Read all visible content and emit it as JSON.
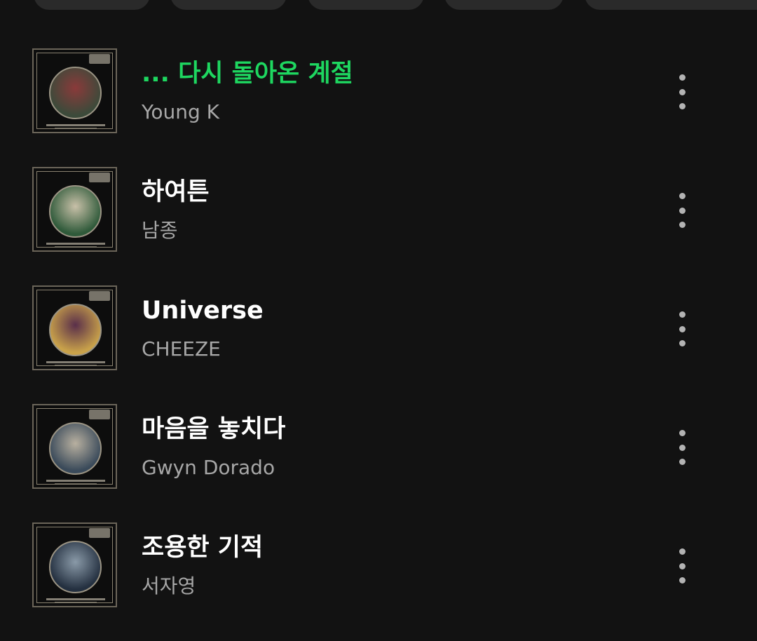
{
  "filter_chips": [
    {
      "label": ""
    },
    {
      "label": ""
    },
    {
      "label": ""
    },
    {
      "label": ""
    },
    {
      "label": ""
    }
  ],
  "tracks": [
    {
      "title": "... 다시 돌아온 계절",
      "artist": "Young K",
      "is_playing": true,
      "art_theme": {
        "circle": "#3c4a3a",
        "accent": "#8a3a3a"
      }
    },
    {
      "title": "하여튼",
      "artist": "남종",
      "is_playing": false,
      "art_theme": {
        "circle": "#2f5a3a",
        "accent": "#c8c0a8"
      }
    },
    {
      "title": "Universe",
      "artist": "CHEEZE",
      "is_playing": false,
      "art_theme": {
        "circle": "#c9a24a",
        "accent": "#5a2f4a"
      }
    },
    {
      "title": "마음을 놓치다",
      "artist": "Gwyn Dorado",
      "is_playing": false,
      "art_theme": {
        "circle": "#3a4a5a",
        "accent": "#b8b0a0"
      }
    },
    {
      "title": "조용한 기적",
      "artist": "서자영",
      "is_playing": false,
      "art_theme": {
        "circle": "#243040",
        "accent": "#8a9aa8"
      }
    }
  ],
  "colors": {
    "background": "#121212",
    "title": "#ffffff",
    "playing_title": "#1ed760",
    "artist": "#a7a7a7",
    "more_icon": "#b3b3b3",
    "chip": "#2a2a2a"
  },
  "icons": {
    "more_options": "vertical-ellipsis-icon"
  }
}
